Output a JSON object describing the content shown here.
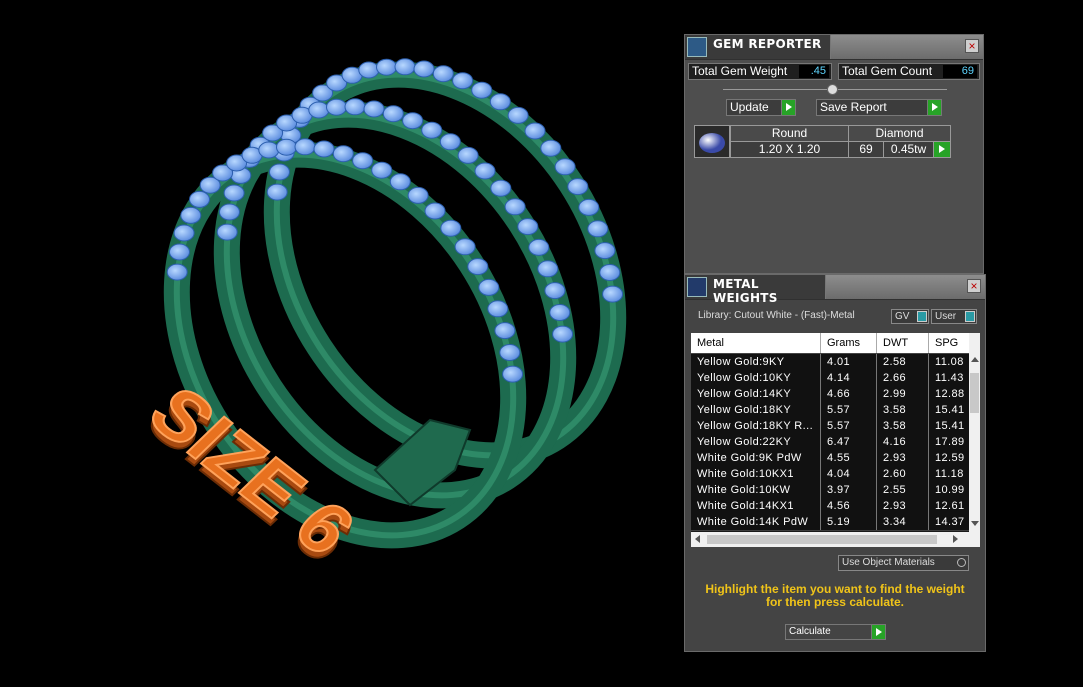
{
  "viewport": {
    "label": "SIZE 6"
  },
  "gem_reporter": {
    "title": "GEM REPORTER",
    "close": "×",
    "total_weight_label": "Total Gem Weight",
    "total_weight_value": ".45",
    "total_count_label": "Total Gem Count",
    "total_count_value": "69",
    "update_label": "Update",
    "save_label": "Save Report",
    "table": {
      "shape": "Round",
      "material": "Diamond",
      "size": "1.20 X 1.20",
      "count": "69",
      "weight": "0.45tw"
    }
  },
  "metal_weights": {
    "title": "METAL WEIGHTS",
    "close": "×",
    "library": "Library: Cutout White - (Fast)-Metal",
    "gv_label": "GV",
    "user_label": "User",
    "columns": [
      "Metal",
      "Grams",
      "DWT",
      "SPG"
    ],
    "rows": [
      [
        "Yellow Gold:9KY",
        "4.01",
        "2.58",
        "11.08"
      ],
      [
        "Yellow Gold:10KY",
        "4.14",
        "2.66",
        "11.43"
      ],
      [
        "Yellow Gold:14KY",
        "4.66",
        "2.99",
        "12.88"
      ],
      [
        "Yellow Gold:18KY",
        "5.57",
        "3.58",
        "15.41"
      ],
      [
        "Yellow Gold:18KY R...",
        "5.57",
        "3.58",
        "15.41"
      ],
      [
        "Yellow Gold:22KY",
        "6.47",
        "4.16",
        "17.89"
      ],
      [
        "White Gold:9K PdW",
        "4.55",
        "2.93",
        "12.59"
      ],
      [
        "White Gold:10KX1",
        "4.04",
        "2.60",
        "11.18"
      ],
      [
        "White Gold:10KW",
        "3.97",
        "2.55",
        "10.99"
      ],
      [
        "White Gold:14KX1",
        "4.56",
        "2.93",
        "12.61"
      ],
      [
        "White Gold:14K PdW",
        "5.19",
        "3.34",
        "14.37"
      ]
    ],
    "use_object_materials": "Use Object Materials",
    "hint_line1": "Highlight the item you want to find the weight",
    "hint_line2": "for then press calculate.",
    "calculate_label": "Calculate",
    "colors": {
      "hint": "#f0c419",
      "value": "#5fd6ff",
      "play": "#27a327"
    }
  }
}
